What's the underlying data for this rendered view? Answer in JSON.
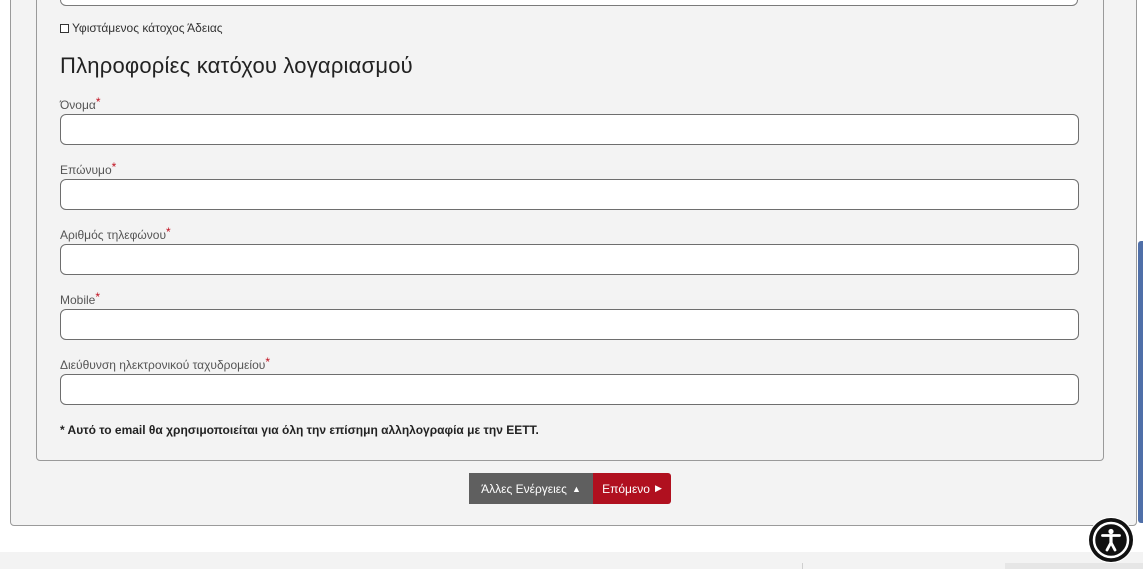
{
  "form": {
    "existing_holder_label": "Υφιστάμενος κάτοχος Άδειας",
    "section_title": "Πληροφορίες κατόχου λογαριασμού",
    "required_marker": "*",
    "fields": [
      {
        "label": "Όνομα",
        "value": "",
        "placeholder": ""
      },
      {
        "label": "Επώνυμο",
        "value": "",
        "placeholder": ""
      },
      {
        "label": "Αριθμός τηλεφώνου",
        "value": "",
        "placeholder": ""
      },
      {
        "label": "Mobile",
        "value": "",
        "placeholder": ""
      },
      {
        "label": "Διεύθυνση ηλεκτρονικού ταχυδρομείου",
        "value": "",
        "placeholder": ""
      }
    ],
    "email_note": "* Αυτό το email θα χρησιμοποιείται για όλη την επίσημη αλληλογραφία με την ΕΕΤΤ."
  },
  "actions": {
    "other_actions_label": "Άλλες Ενέργειες",
    "next_label": "Επόμενο"
  },
  "icons": {
    "accessibility": "accessibility-icon",
    "other_actions_arrow": "triangle-up-icon",
    "next_arrow": "triangle-right-icon"
  },
  "colors": {
    "next_button": "#b0101f",
    "other_button": "#5f5f5f",
    "required_marker": "#c0101f",
    "side_tab": "#4f6fa8"
  }
}
